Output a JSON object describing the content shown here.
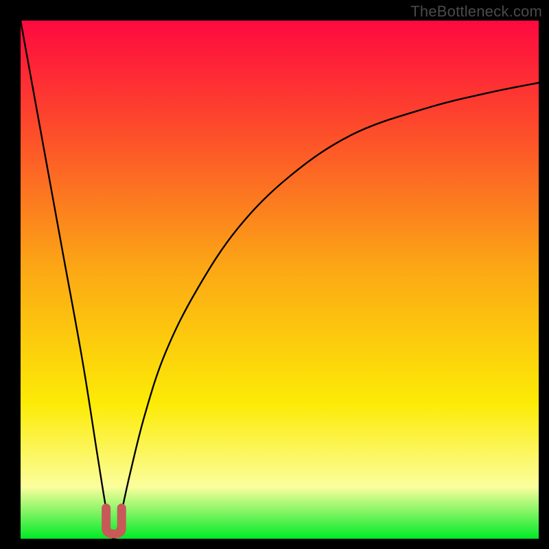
{
  "watermark": "TheBottleneck.com",
  "colors": {
    "frame": "#000000",
    "gradient_top": "#fe093f",
    "gradient_upper_mid": "#fd4f2a",
    "gradient_mid": "#fca815",
    "gradient_lower_mid": "#fceb06",
    "gradient_pale": "#fbfe9d",
    "gradient_bottom": "#00ea27",
    "curve": "#000000",
    "marker": "#c75959"
  },
  "chart_data": {
    "type": "line",
    "title": "",
    "xlabel": "",
    "ylabel": "",
    "xlim": [
      0,
      100
    ],
    "ylim": [
      0,
      100
    ],
    "series": [
      {
        "name": "bottleneck-curve",
        "note": "V-shaped bottleneck curve; minimum near x≈18, y=0. Left branch rises steeply to (0,100). Right branch rises with decreasing slope toward (100,~88).",
        "x": [
          0,
          4,
          8,
          12,
          15,
          17,
          18,
          19,
          21,
          24,
          28,
          34,
          42,
          52,
          64,
          78,
          90,
          100
        ],
        "y": [
          100,
          78,
          56,
          34,
          15,
          3,
          0,
          3,
          12,
          24,
          36,
          48,
          60,
          70,
          78,
          83,
          86,
          88
        ]
      }
    ],
    "marker": {
      "name": "optimal-point",
      "shape": "U",
      "x": 18,
      "y": 0,
      "width_x_units": 3,
      "height_y_units": 5,
      "color": "#c75959"
    }
  }
}
